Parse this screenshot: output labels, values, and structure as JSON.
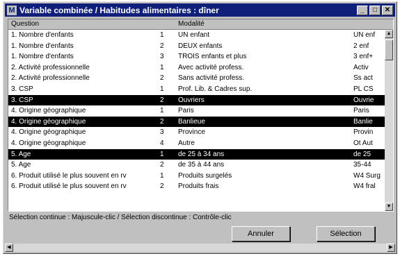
{
  "window": {
    "title": "Variable combinée / Habitudes alimentaires : dîner",
    "icon": "window-app-icon",
    "controls": {
      "minimize": "_",
      "maximize": "□",
      "close": "✕"
    }
  },
  "table": {
    "headers": {
      "question": "Question",
      "modality": "Modalité"
    },
    "rows": [
      {
        "question": "1. Nombre d'enfants",
        "num": "1",
        "modality": "UN enfant",
        "code": "UN enf",
        "selected": false
      },
      {
        "question": "1. Nombre d'enfants",
        "num": "2",
        "modality": "DEUX enfants",
        "code": "2 enf",
        "selected": false
      },
      {
        "question": "1. Nombre d'enfants",
        "num": "3",
        "modality": "TROIS enfants et plus",
        "code": "3 enf+",
        "selected": false
      },
      {
        "question": "2. Activité professionnelle",
        "num": "1",
        "modality": "Avec activité profess.",
        "code": "Activ",
        "selected": false
      },
      {
        "question": "2. Activité professionnelle",
        "num": "2",
        "modality": "Sans activité profess.",
        "code": "Ss act",
        "selected": false
      },
      {
        "question": "3. CSP",
        "num": "1",
        "modality": "Prof. Lib. & Cadres sup.",
        "code": "PL CS",
        "selected": false
      },
      {
        "question": "3. CSP",
        "num": "2",
        "modality": "Ouvriers",
        "code": "Ouvrie",
        "selected": true
      },
      {
        "question": "4. Origine géographique",
        "num": "1",
        "modality": "Paris",
        "code": "Paris",
        "selected": false
      },
      {
        "question": "4. Origine géographique",
        "num": "2",
        "modality": "Banlieue",
        "code": "Banlie",
        "selected": true
      },
      {
        "question": "4. Origine géographique",
        "num": "3",
        "modality": "Province",
        "code": "Provin",
        "selected": false
      },
      {
        "question": "4. Origine géographique",
        "num": "4",
        "modality": "Autre",
        "code": "Ot Aut",
        "selected": false
      },
      {
        "question": "5. Age",
        "num": "1",
        "modality": "de 25 à 34 ans",
        "code": "de 25",
        "selected": true
      },
      {
        "question": "5. Age",
        "num": "2",
        "modality": "de 35 à 44 ans",
        "code": "35-44",
        "selected": false
      },
      {
        "question": "6. Produit utilisé le plus souvent en rv",
        "num": "1",
        "modality": "Produits surgelés",
        "code": "W4 Surg",
        "selected": false
      },
      {
        "question": "6. Produit utilisé le plus souvent en rv",
        "num": "2",
        "modality": "Produits frais",
        "code": "W4 fral",
        "selected": false
      }
    ]
  },
  "status_text": "Sélection continue : Majuscule-clic / Sélection discontinue : Contrôle-clic",
  "buttons": {
    "cancel": "Annuler",
    "select": "Sélection"
  },
  "colors": {
    "titlebar": "#10207a",
    "selection": "#000000"
  }
}
